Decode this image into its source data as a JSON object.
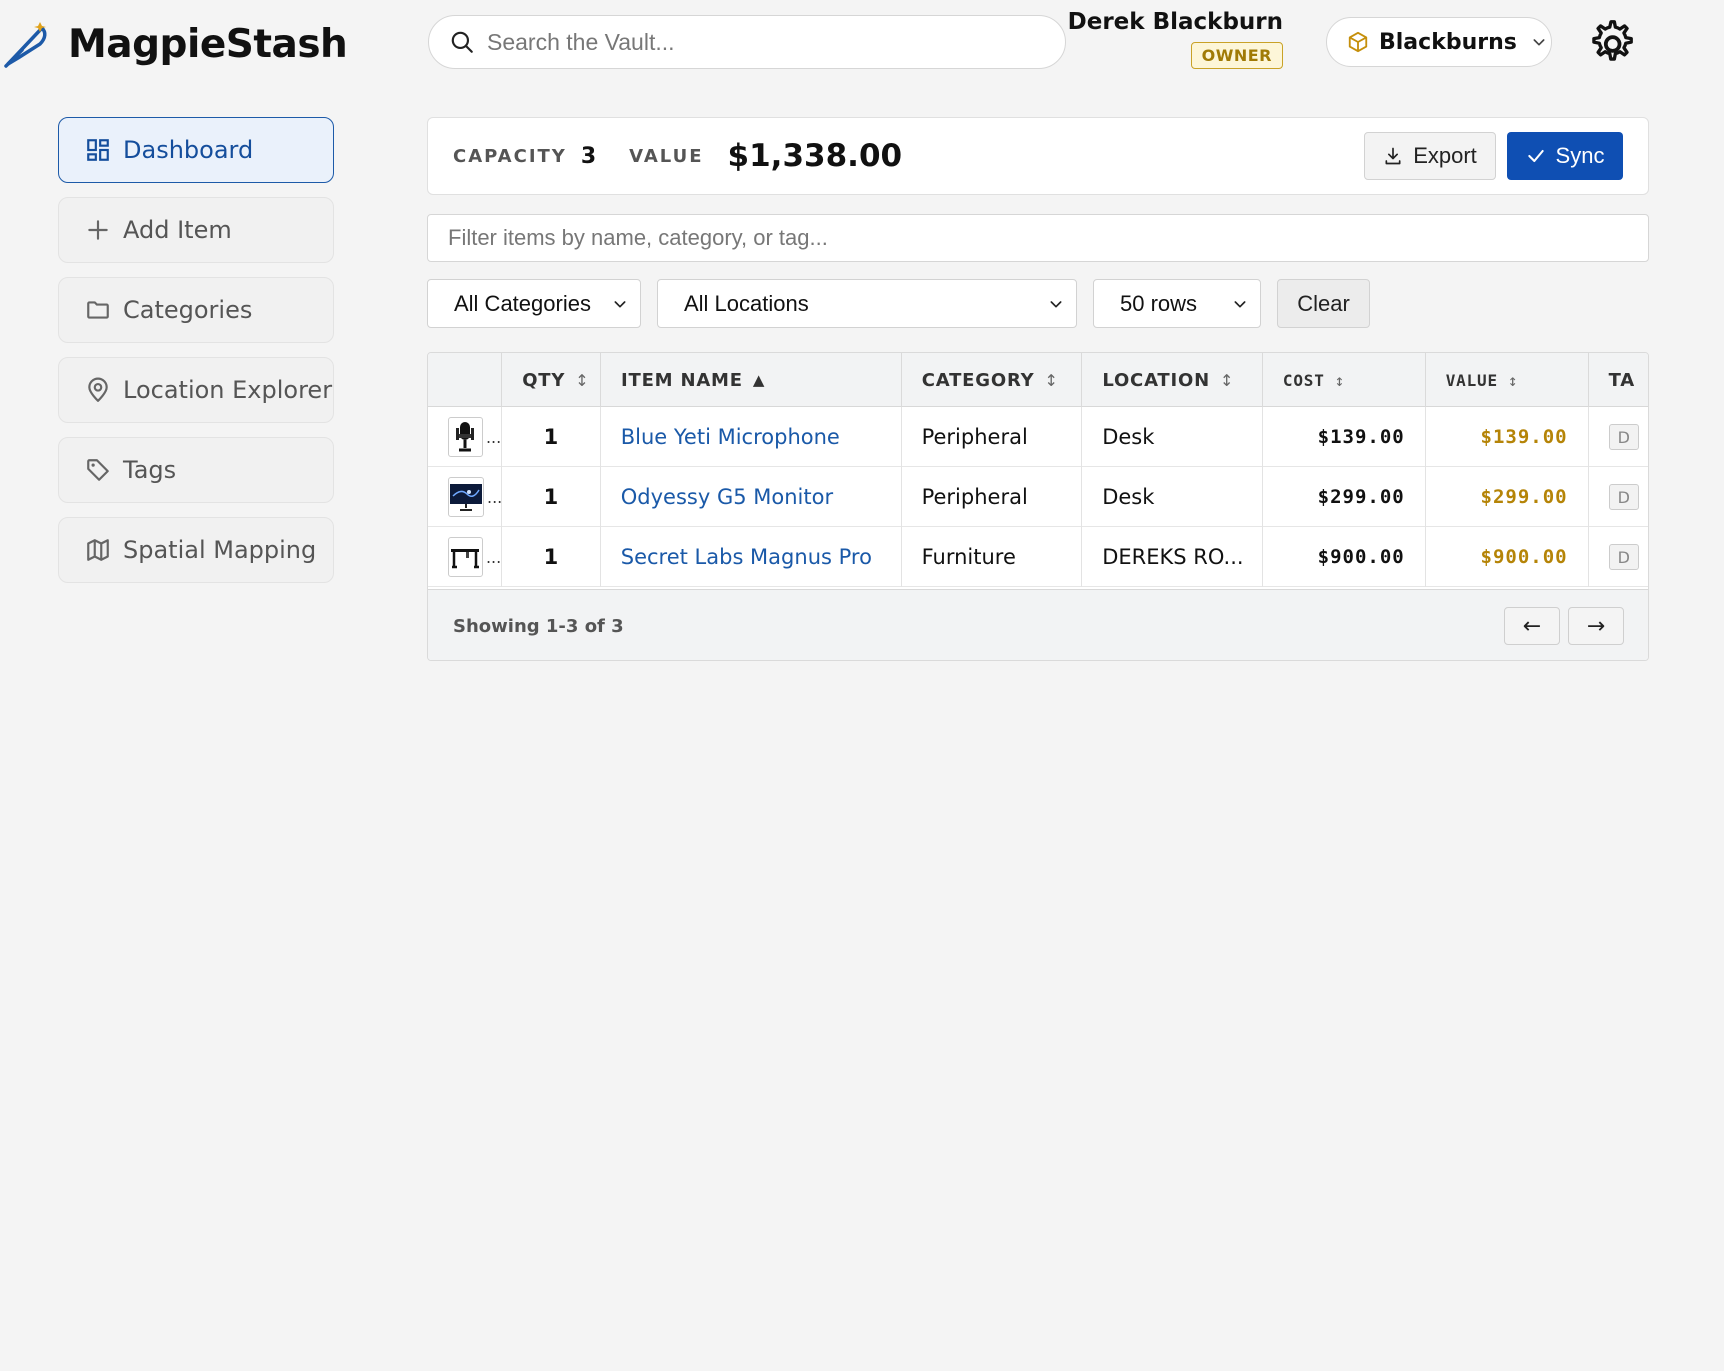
{
  "app": {
    "name": "MagpieStash",
    "search_placeholder": "Search the Vault..."
  },
  "user": {
    "name": "Derek Blackburn",
    "role": "OWNER"
  },
  "vault": {
    "name": "Blackburns"
  },
  "sidebar": {
    "items": [
      {
        "label": "Dashboard",
        "icon": "dashboard-icon",
        "active": true
      },
      {
        "label": "Add Item",
        "icon": "plus-icon"
      },
      {
        "label": "Categories",
        "icon": "folder-icon"
      },
      {
        "label": "Location Explorer",
        "icon": "map-pin-icon"
      },
      {
        "label": "Tags",
        "icon": "tag-icon"
      },
      {
        "label": "Spatial Mapping",
        "icon": "map-icon"
      }
    ]
  },
  "stats": {
    "capacity_label": "CAPACITY",
    "capacity_value": "3",
    "value_label": "VALUE",
    "value_value": "$1,338.00",
    "export_label": "Export",
    "sync_label": "Sync"
  },
  "filters": {
    "text_placeholder": "Filter items by name, category, or tag...",
    "category": "All Categories",
    "location": "All Locations",
    "rows": "50 rows",
    "clear_label": "Clear"
  },
  "table": {
    "columns": [
      {
        "key": "thumb",
        "label": ""
      },
      {
        "key": "qty",
        "label": "QTY",
        "sort": "↕"
      },
      {
        "key": "name",
        "label": "ITEM NAME",
        "sort": "▲"
      },
      {
        "key": "category",
        "label": "CATEGORY",
        "sort": "↕"
      },
      {
        "key": "location",
        "label": "LOCATION",
        "sort": "↕"
      },
      {
        "key": "cost",
        "label": "COST",
        "sort": "↕"
      },
      {
        "key": "value",
        "label": "VALUE",
        "sort": "↕"
      },
      {
        "key": "tags",
        "label": "TA"
      }
    ],
    "rows": [
      {
        "thumb_ellipsis": "...",
        "qty": "1",
        "name": "Blue Yeti Microphone",
        "category": "Peripheral",
        "location": "Desk",
        "cost": "$139.00",
        "value": "$139.00",
        "tag": "D"
      },
      {
        "thumb_ellipsis": "...",
        "qty": "1",
        "name": "Odyessy G5 Monitor",
        "category": "Peripheral",
        "location": "Desk",
        "cost": "$299.00",
        "value": "$299.00",
        "tag": "D"
      },
      {
        "thumb_ellipsis": "...",
        "qty": "1",
        "name": "Secret Labs Magnus Pro",
        "category": "Furniture",
        "location": "DEREKS RO...",
        "cost": "$900.00",
        "value": "$900.00",
        "tag": "D"
      }
    ],
    "footer": {
      "showing": "Showing 1-3 of 3",
      "prev": "←",
      "next": "→"
    }
  },
  "colors": {
    "accent": "#0f4fb3",
    "link": "#1a59a8",
    "gold": "#b58407"
  }
}
